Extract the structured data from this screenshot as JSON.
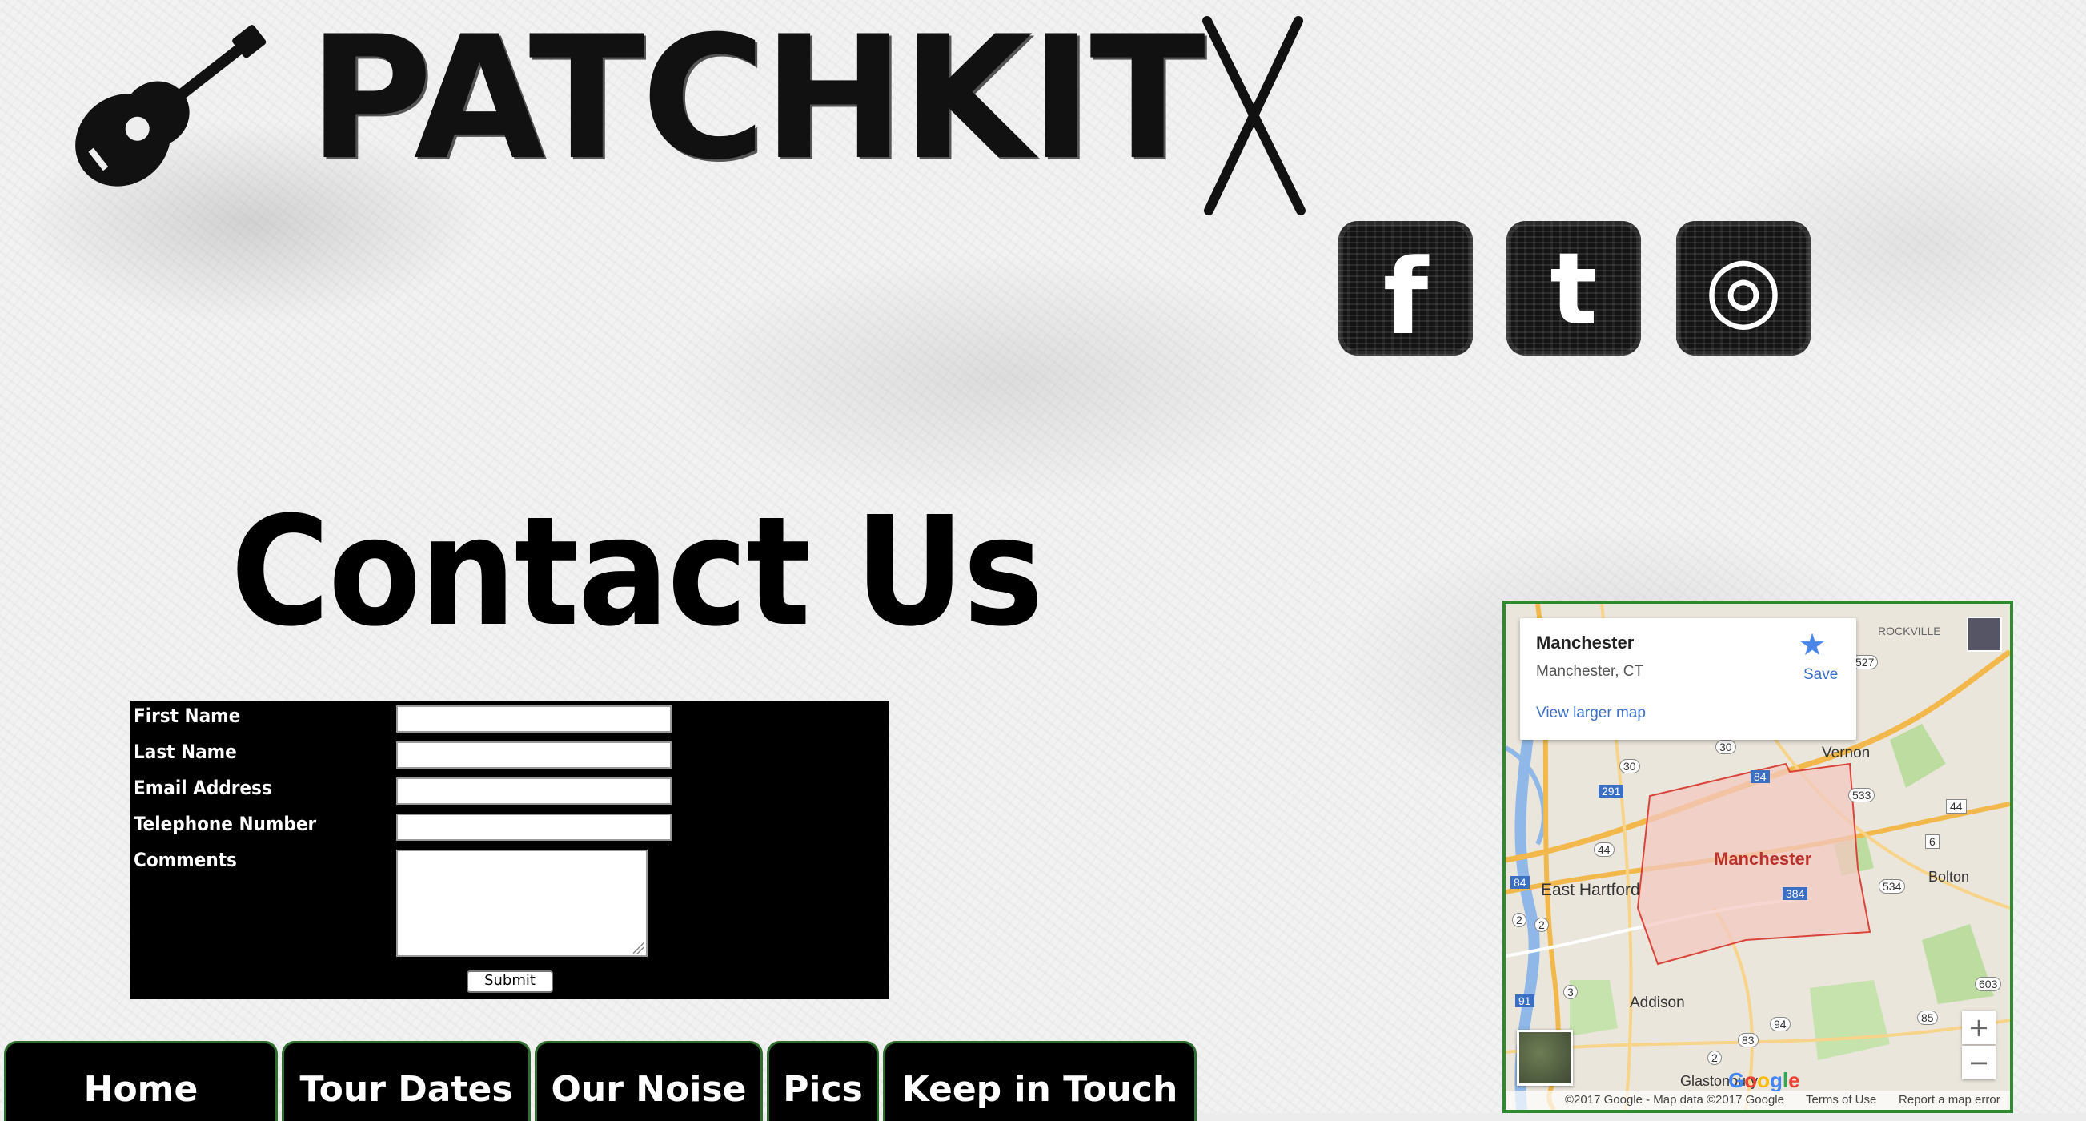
{
  "header": {
    "logo_text": "PATCHKIT"
  },
  "social": {
    "facebook_glyph": "f",
    "twitter_glyph": "t",
    "instagram_glyph": "◎"
  },
  "main": {
    "heading": "Contact Us"
  },
  "form": {
    "first_name_label": "First Name",
    "last_name_label": "Last Name",
    "email_label": "Email Address",
    "phone_label": "Telephone Number",
    "comments_label": "Comments",
    "submit_label": "Submit"
  },
  "nav": {
    "tabs": [
      {
        "label": "Home"
      },
      {
        "label": "Tour Dates"
      },
      {
        "label": "Our Noise"
      },
      {
        "label": "Pics"
      },
      {
        "label": "Keep in Touch"
      }
    ]
  },
  "map": {
    "place_title": "Manchester",
    "place_subtitle": "Manchester, CT",
    "view_larger": "View larger map",
    "save_label": "Save",
    "zoom_in": "+",
    "zoom_out": "−",
    "region_label": "Manchester",
    "labels": [
      "ROCKVILLE",
      "Vernon",
      "East Hartford",
      "Bolton",
      "Addison",
      "Glastonbury"
    ],
    "shields": [
      "527",
      "30",
      "30",
      "291",
      "84",
      "533",
      "44",
      "6",
      "44",
      "534",
      "84",
      "384",
      "2",
      "3",
      "91",
      "2",
      "94",
      "83",
      "85",
      "603",
      "2"
    ],
    "logo": "Google",
    "footer": {
      "copyright": "©2017 Google - Map data ©2017 Google",
      "terms": "Terms of Use",
      "report": "Report a map error"
    },
    "colors": {
      "region_fill": "#f3c8c0",
      "region_stroke": "#d9443a",
      "water": "#8fb8e8",
      "highway": "#f2b84b",
      "park": "#b9d99a"
    }
  },
  "colors": {
    "nav_border": "#2f6e2f",
    "map_border": "#2e8a2e"
  }
}
